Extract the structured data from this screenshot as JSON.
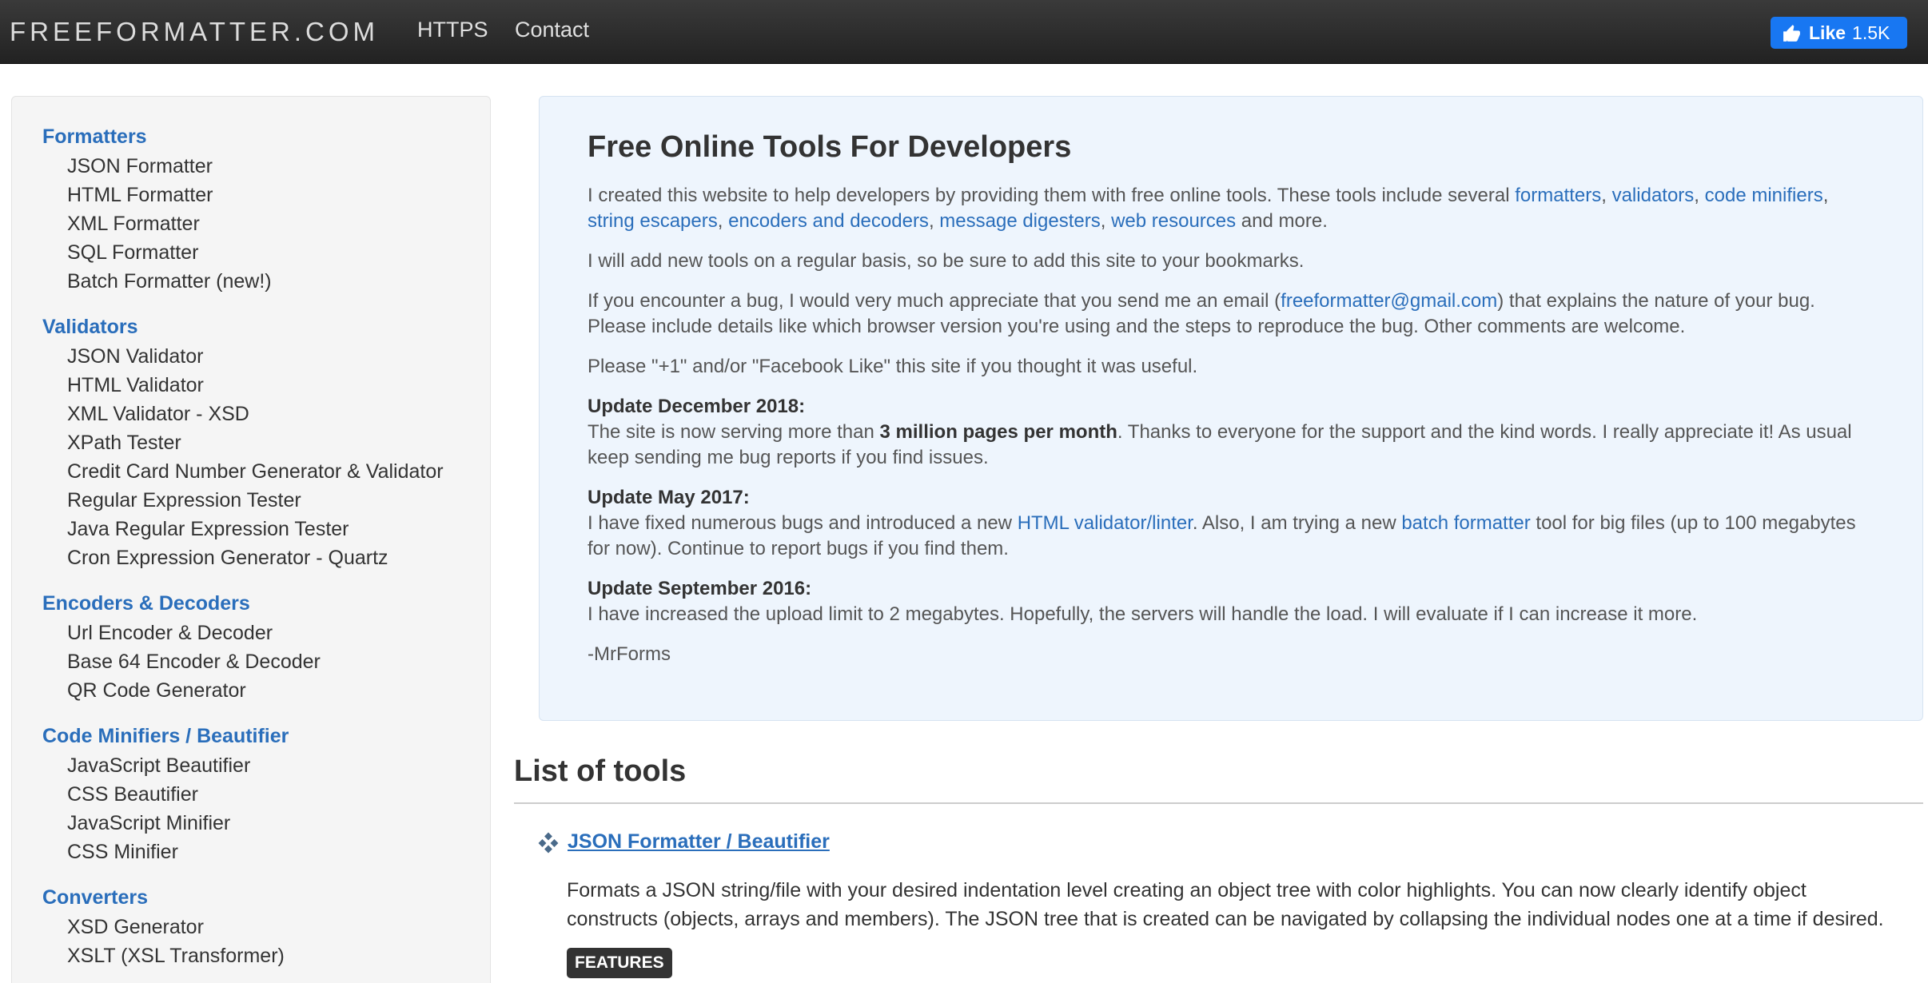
{
  "navbar": {
    "brand": "FREEFORMATTER.COM",
    "links": [
      "HTTPS",
      "Contact"
    ],
    "like_label": "Like",
    "like_count": "1.5K"
  },
  "sidebar": {
    "groups": [
      {
        "heading": "Formatters",
        "items": [
          "JSON Formatter",
          "HTML Formatter",
          "XML Formatter",
          "SQL Formatter",
          "Batch Formatter (new!)"
        ]
      },
      {
        "heading": "Validators",
        "items": [
          "JSON Validator",
          "HTML Validator",
          "XML Validator - XSD",
          "XPath Tester",
          "Credit Card Number Generator & Validator",
          "Regular Expression Tester",
          "Java Regular Expression Tester",
          "Cron Expression Generator - Quartz"
        ]
      },
      {
        "heading": "Encoders & Decoders",
        "items": [
          "Url Encoder & Decoder",
          "Base 64 Encoder & Decoder",
          "QR Code Generator"
        ]
      },
      {
        "heading": "Code Minifiers / Beautifier",
        "items": [
          "JavaScript Beautifier",
          "CSS Beautifier",
          "JavaScript Minifier",
          "CSS Minifier"
        ]
      },
      {
        "heading": "Converters",
        "items": [
          "XSD Generator",
          "XSLT (XSL Transformer)"
        ]
      }
    ]
  },
  "intro": {
    "title": "Free Online Tools For Developers",
    "p1_pre": "I created this website to help developers by providing them with free online tools. These tools include several ",
    "p1_links": [
      "formatters",
      "validators",
      "code minifiers",
      "string escapers",
      "encoders and decoders",
      "message digesters",
      "web resources"
    ],
    "p1_sep": ", ",
    "p1_post": " and more.",
    "p2": "I will add new tools on a regular basis, so be sure to add this site to your bookmarks.",
    "p3_pre": "If you encounter a bug, I would very much appreciate that you send me an email (",
    "p3_email": "freeformatter@gmail.com",
    "p3_post": ") that explains the nature of your bug. Please include details like which browser version you're using and the steps to reproduce the bug. Other comments are welcome.",
    "p4": "Please \"+1\" and/or \"Facebook Like\" this site if you thought it was useful.",
    "u1_title": "Update December 2018:",
    "u1_pre": "The site is now serving more than ",
    "u1_bold": "3 million pages per month",
    "u1_post": ". Thanks to everyone for the support and the kind words. I really appreciate it! As usual keep sending me bug reports if you find issues.",
    "u2_title": "Update May 2017:",
    "u2_pre": "I have fixed numerous bugs and introduced a new ",
    "u2_link1": "HTML validator/linter",
    "u2_mid": ". Also, I am trying a new ",
    "u2_link2": "batch formatter",
    "u2_post": " tool for big files (up to 100 megabytes for now). Continue to report bugs if you find them.",
    "u3_title": "Update September 2016:",
    "u3_text": "I have increased the upload limit to 2 megabytes. Hopefully, the servers will handle the load. I will evaluate if I can increase it more.",
    "signature": "-MrForms"
  },
  "tools": {
    "title": "List of tools",
    "first": {
      "name": "JSON Formatter / Beautifier",
      "description": "Formats a JSON string/file with your desired indentation level creating an object tree with color highlights. You can now clearly identify object constructs (objects, arrays and members). The JSON tree that is created can be navigated by collapsing the individual nodes one at a time if desired.",
      "badge": "FEATURES"
    }
  },
  "colors": {
    "link": "#2a6ebb",
    "navbar": "#222222",
    "fb_blue": "#1877f2",
    "intro_bg": "#eef5fd",
    "sidebar_bg": "#f5f5f5"
  }
}
